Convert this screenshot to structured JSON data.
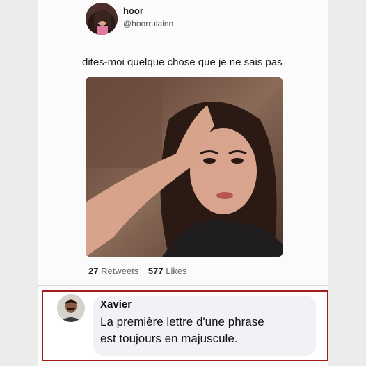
{
  "tweet": {
    "author_name": "hoor",
    "author_handle": "@hoorrulainn",
    "text": "dites-moi quelque chose que je ne sais pas",
    "retweets_count": "27",
    "retweets_label": "Retweets",
    "likes_count": "577",
    "likes_label": "Likes"
  },
  "reply": {
    "author_name": "Xavier",
    "line1": "La première lettre d'une phrase",
    "line2": "est toujours en majuscule."
  },
  "colors": {
    "highlight_border": "#a31c1c",
    "bubble_bg": "#f0f2f5"
  }
}
